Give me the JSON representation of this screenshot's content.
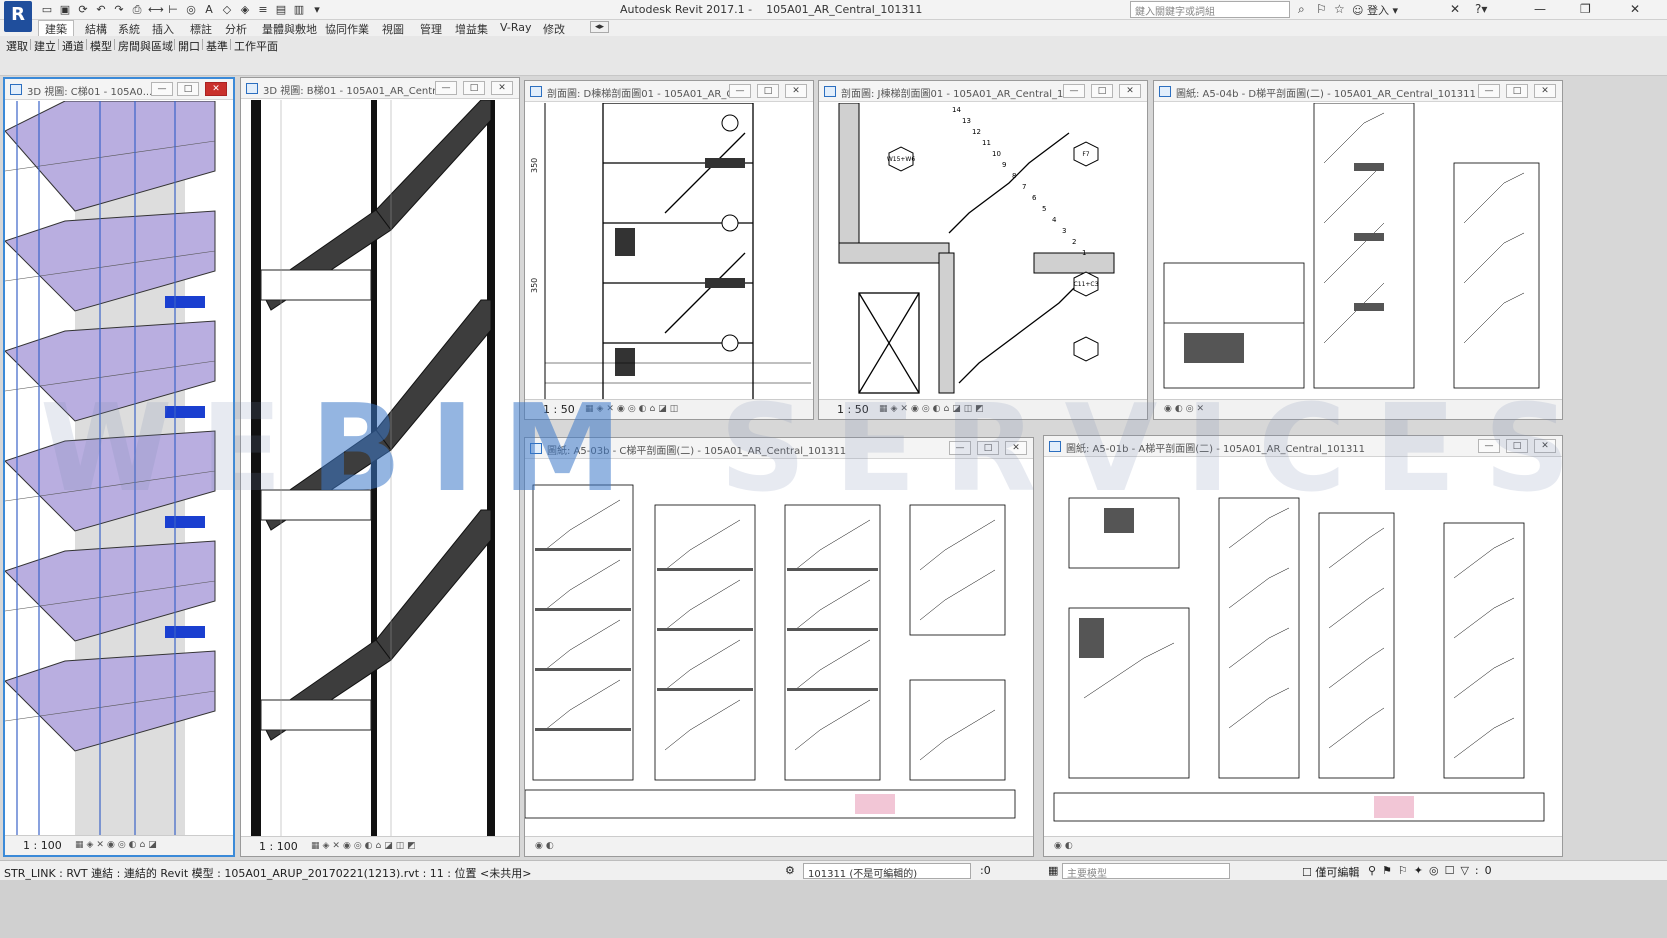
{
  "app": {
    "logo": "R",
    "title": "Autodesk Revit 2017.1 -    105A01_AR_Central_101311",
    "search_placeholder": "鍵入關鍵字或詞組",
    "signin": "登入"
  },
  "tabs": [
    "建築",
    "結構",
    "系統",
    "插入",
    "標註",
    "分析",
    "量體與敷地",
    "協同作業",
    "視圖",
    "管理",
    "增益集",
    "V-Ray",
    "修改"
  ],
  "ribbon": [
    "選取",
    "建立",
    "通道",
    "模型",
    "房間與區域",
    "開口",
    "基準",
    "工作平面"
  ],
  "views": [
    {
      "title": "3D 視圖: C梯01 - 105A0...",
      "scale": "1 : 100"
    },
    {
      "title": "3D 視圖: B梯01 - 105A01_AR_Centr...",
      "scale": "1 : 100"
    },
    {
      "title": "剖面圖: D棟梯剖面圖01 - 105A01_AR_C...",
      "scale": "1 : 50"
    },
    {
      "title": "剖面圖: J棟梯剖面圖01 - 105A01_AR_Central_10...",
      "scale": "1 : 50"
    },
    {
      "title": "圖紙: A5-04b - D梯平剖面圖(二) - 105A01_AR_Central_101311",
      "scale": ""
    },
    {
      "title": "圖紙: A5-03b - C梯平剖面圖(二) - 105A01_AR_Central_101311",
      "scale": ""
    },
    {
      "title": "圖紙: A5-01b - A梯平剖面圖(二) - 105A01_AR_Central_101311",
      "scale": ""
    }
  ],
  "labels": {
    "elev_marks": [
      "350",
      "350"
    ],
    "tags": [
      "W15+W6",
      "F7",
      "C11+C3"
    ],
    "section_numbers": [
      "14",
      "13",
      "12",
      "11",
      "10",
      "9",
      "8",
      "7",
      "6",
      "5",
      "4",
      "3",
      "2",
      "1"
    ]
  },
  "watermark": "WEBIM SERVICES",
  "status": {
    "text": "STR_LINK : RVT 連結 : 連結的 Revit 模型 : 105A01_ARUP_20170221(1213).rvt : 11 : 位置 <未共用>",
    "workset": "101311 (不是可編輯的)",
    "sel_count": ":0",
    "design_option": "主要模型",
    "editable": "僅可編輯"
  }
}
